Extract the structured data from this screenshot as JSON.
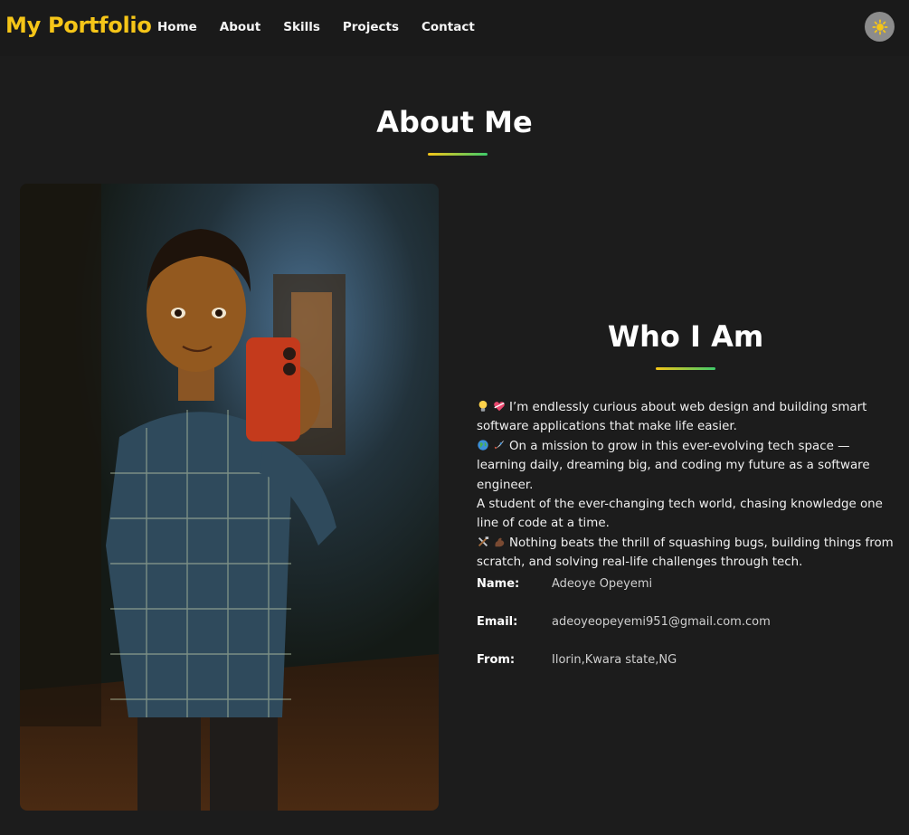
{
  "header": {
    "brand": "My Portfolio",
    "nav": [
      "Home",
      "About",
      "Skills",
      "Projects",
      "Contact"
    ],
    "theme_toggle_icon": "sun-icon"
  },
  "about": {
    "title": "About Me",
    "photo_icon": "portrait-image",
    "who_title": "Who I Am",
    "bio": [
      {
        "icons": [
          "lightbulb-icon",
          "heart-icon"
        ],
        "text": "I’m endlessly curious about web design and building smart software applications that make life easier."
      },
      {
        "icons": [
          "globe-icon",
          "rocket-icon"
        ],
        "text": "On a mission to grow in this ever-evolving tech space — learning daily, dreaming big, and coding my future as a software engineer."
      },
      {
        "icons": [],
        "text": "A student of the ever-changing tech world, chasing knowledge one line of code at a time."
      },
      {
        "icons": [
          "tools-icon",
          "muscle-icon"
        ],
        "text": "Nothing beats the thrill of squashing bugs, building things from scratch, and solving real-life challenges through tech."
      }
    ],
    "info": [
      {
        "label": "Name:",
        "value": "Adeoye Opeyemi"
      },
      {
        "label": "Email:",
        "value": "adeoyeopeyemi951@gmail.com.com"
      },
      {
        "label": "From:",
        "value": "Ilorin,Kwara state,NG"
      }
    ]
  },
  "colors": {
    "accent": "#f5c518",
    "accent_end": "#3ecb6a",
    "background": "#1c1c1c"
  }
}
